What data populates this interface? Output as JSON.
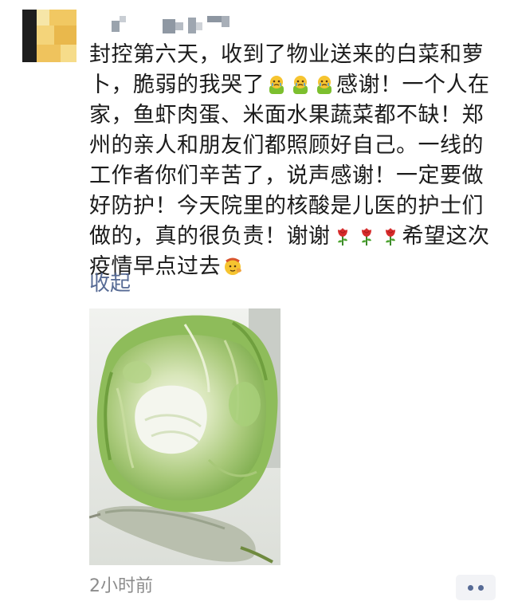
{
  "post": {
    "author_name": "",
    "text_lines": [
      [
        "封控第六天，收到了物业送来的白菜和萝"
      ],
      [
        "卜，脆弱的我哭了",
        "{cry}",
        "{cry}",
        "{cry}",
        "感谢！一个人在"
      ],
      [
        "家，鱼虾肉蛋、米面水果蔬菜都不缺！郑"
      ],
      [
        "州的亲人和朋友们都照顾好自己。一线的"
      ],
      [
        "工作者你们辛苦了，说声感谢！一定要做"
      ],
      [
        "好防护！今天院里的核酸是儿医的护士们"
      ],
      [
        "做的，真的很负责！谢谢",
        "{rose}",
        "{rose}",
        "{rose}",
        "希望这次"
      ],
      [
        "疫情早点过去",
        "{salute}"
      ]
    ],
    "collapse_label": "收起",
    "image": {
      "subject": "photo of a napa cabbage and a radish on a table"
    },
    "timestamp": "2小时前",
    "more_button_icon": "more-dots-icon"
  },
  "colors": {
    "link": "#576b95",
    "text": "#1b1b1b",
    "muted": "#8c8c8c",
    "more_button_bg": "#f2f3f6"
  },
  "icons": {
    "cry": "crying-face-emoji-icon",
    "rose": "rose-emoji-icon",
    "salute": "salute-face-emoji-icon"
  }
}
